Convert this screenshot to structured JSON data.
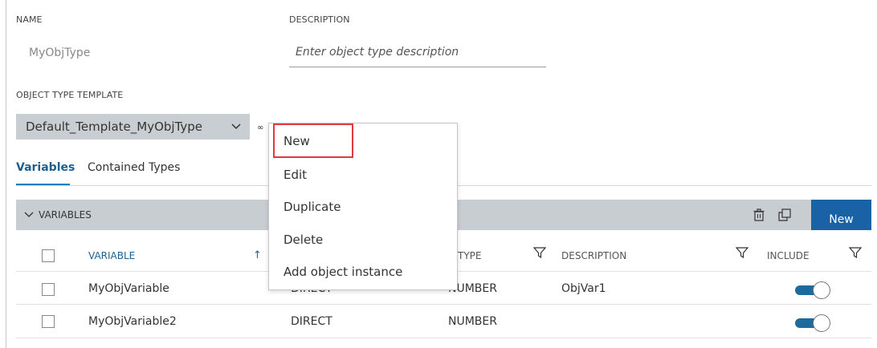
{
  "form": {
    "name_label": "NAME",
    "name_value": "MyObjType",
    "description_label": "DESCRIPTION",
    "description_placeholder": "Enter object type description",
    "template_label": "OBJECT TYPE TEMPLATE",
    "template_value": "Default_Template_MyObjType",
    "more_glyph": "∞"
  },
  "tabs": [
    {
      "label": "Variables",
      "active": true
    },
    {
      "label": "Contained Types",
      "active": false
    }
  ],
  "section": {
    "title": "VARIABLES",
    "new_button": "New",
    "icons": [
      "trash-icon",
      "copy-icon",
      "chevron-down-icon",
      "filter-icon",
      "sort-up-icon"
    ]
  },
  "table": {
    "columns": [
      "VARIABLE",
      "TYPE",
      "DESCRIPTION",
      "INCLUDE"
    ],
    "rows": [
      {
        "variable": "MyObjVariable",
        "source": "DIRECT",
        "type": "NUMBER",
        "description": "ObjVar1",
        "include": true
      },
      {
        "variable": "MyObjVariable2",
        "source": "DIRECT",
        "type": "NUMBER",
        "description": "",
        "include": true
      }
    ]
  },
  "menu": {
    "items": [
      "New",
      "Edit",
      "Duplicate",
      "Delete",
      "Add object instance"
    ],
    "highlighted": "New"
  },
  "colors": {
    "accent": "#1a62a6",
    "bar": "#c8cdd2",
    "highlight": "#e0393e",
    "toggle_on": "#1d6a9c"
  }
}
